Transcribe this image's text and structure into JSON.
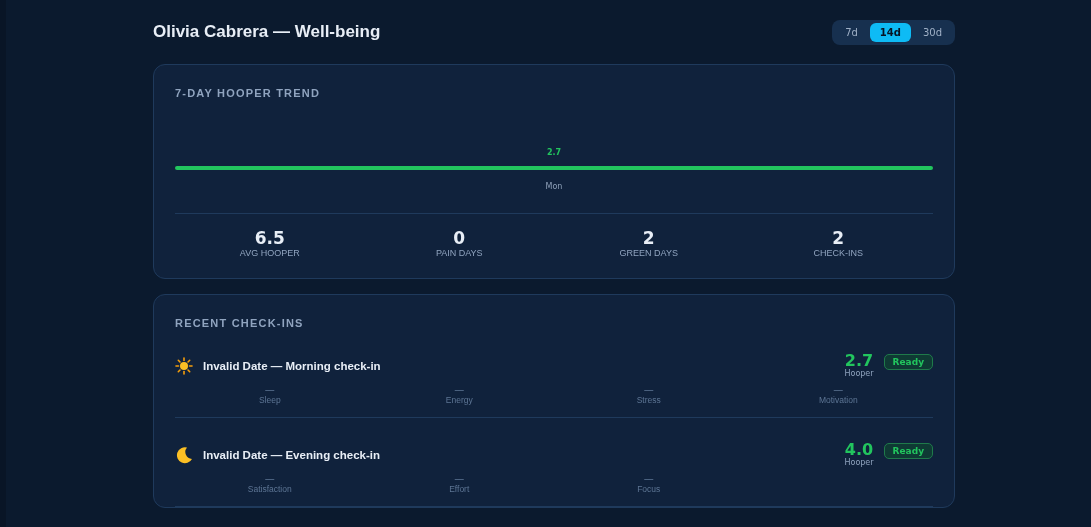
{
  "header": {
    "title": "Olivia Cabrera — Well-being"
  },
  "ranges": [
    {
      "label": "7d",
      "selected": false
    },
    {
      "label": "14d",
      "selected": true
    },
    {
      "label": "30d",
      "selected": false
    }
  ],
  "trend": {
    "title": "7-DAY HOOPER TREND",
    "line": {
      "value_label": "2.7",
      "day_label": "Mon"
    },
    "stats": [
      {
        "value": "6.5",
        "label": "AVG HOOPER"
      },
      {
        "value": "0",
        "label": "PAIN DAYS"
      },
      {
        "value": "2",
        "label": "GREEN DAYS"
      },
      {
        "value": "2",
        "label": "CHECK-INS"
      }
    ]
  },
  "checkins": {
    "title": "RECENT CHECK-INS",
    "items": [
      {
        "kind": "morning",
        "title": "Invalid Date — Morning check-in",
        "score": "2.7",
        "score_label": "Hooper",
        "status": "Ready",
        "metrics": [
          {
            "value": "—",
            "label": "Sleep"
          },
          {
            "value": "—",
            "label": "Energy"
          },
          {
            "value": "—",
            "label": "Stress"
          },
          {
            "value": "—",
            "label": "Motivation"
          }
        ]
      },
      {
        "kind": "evening",
        "title": "Invalid Date — Evening check-in",
        "score": "4.0",
        "score_label": "Hooper",
        "status": "Ready",
        "metrics": [
          {
            "value": "—",
            "label": "Satisfaction"
          },
          {
            "value": "—",
            "label": "Effort"
          },
          {
            "value": "—",
            "label": "Focus"
          }
        ]
      }
    ]
  }
}
